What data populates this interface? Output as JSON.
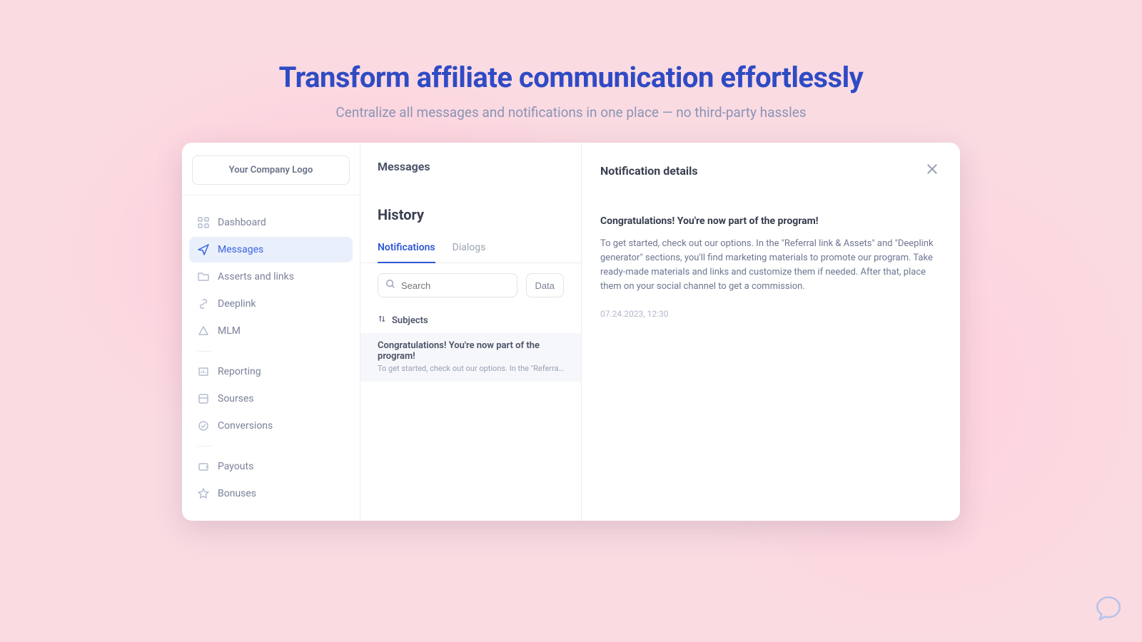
{
  "hero": {
    "title": "Transform affiliate communication effortlessly",
    "subtitle": "Centralize all messages and notifications in one place — no third-party hassles"
  },
  "logo": "Your Company Logo",
  "sidebar": {
    "items": [
      {
        "label": "Dashboard"
      },
      {
        "label": "Messages"
      },
      {
        "label": "Asserts and links"
      },
      {
        "label": "Deeplink"
      },
      {
        "label": "MLM"
      },
      {
        "label": "Reporting"
      },
      {
        "label": "Sourses"
      },
      {
        "label": "Conversions"
      },
      {
        "label": "Payouts"
      },
      {
        "label": "Bonuses"
      }
    ]
  },
  "center": {
    "title": "Messages",
    "section": "History",
    "tabs": {
      "notifications": "Notifications",
      "dialogs": "Dialogs"
    },
    "search_placeholder": "Search",
    "data_button": "Data",
    "column_header": "Subjects",
    "rows": [
      {
        "title": "Congratulations! You're now part of the program!",
        "preview": "To get started, check out our options. In the \"Referral link & Assets\" a"
      }
    ]
  },
  "detail": {
    "header": "Notification details",
    "title": "Congratulations! You're now part of the program!",
    "body": "To get started, check out our options. In the \"Referral link & Assets\" and \"Deeplink generator\" sections, you'll find marketing materials to promote our program. Take ready-made materials and links and customize them if needed. After that, place them on your social channel to get a commission.",
    "date": "07.24.2023, 12:30"
  }
}
